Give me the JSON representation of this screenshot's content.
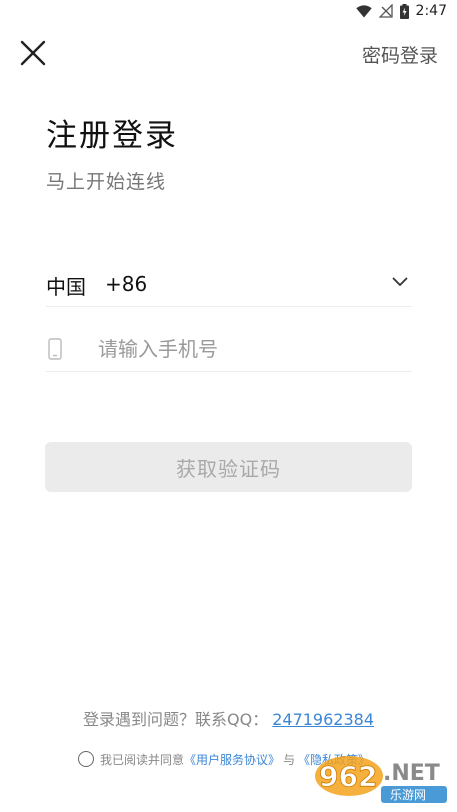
{
  "status": {
    "time": "2:47"
  },
  "header": {
    "password_login": "密码登录"
  },
  "main": {
    "title": "注册登录",
    "subtitle": "马上开始连线",
    "country_name": "中国",
    "country_code": "+86",
    "phone_placeholder": "请输入手机号",
    "phone_value": "",
    "get_code_label": "获取验证码"
  },
  "footer": {
    "help_prefix": "登录遇到问题？联系QQ：",
    "help_qq": "2471962384",
    "agree_prefix": "我已阅读并同意",
    "user_agreement": "《用户服务协议》",
    "agree_and": "与",
    "privacy_policy": "《隐私政策》"
  },
  "watermark": {
    "brand": "962.NET",
    "sub": "乐游网"
  },
  "colors": {
    "link": "#3b86d6",
    "disabled_button_bg": "#ebebeb",
    "disabled_button_text": "#a9a9a9"
  }
}
